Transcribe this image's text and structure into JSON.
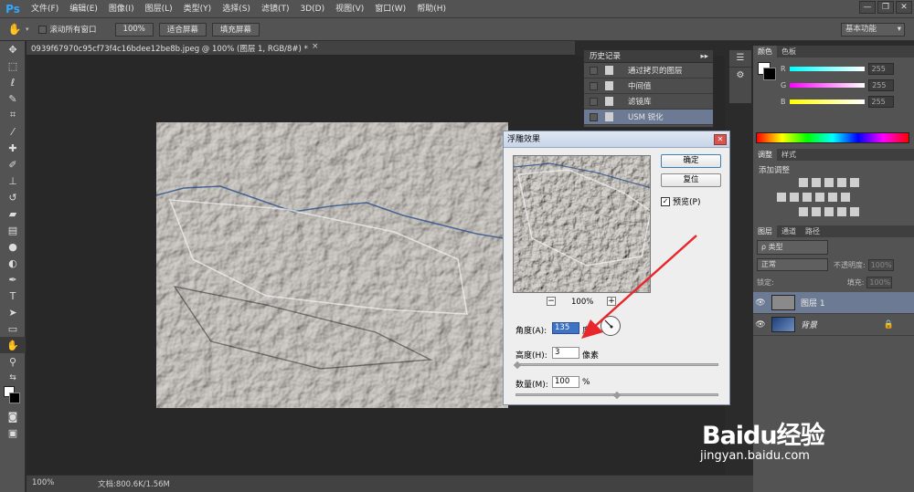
{
  "app": {
    "logo": "Ps"
  },
  "menu": [
    "文件(F)",
    "编辑(E)",
    "图像(I)",
    "图层(L)",
    "类型(Y)",
    "选择(S)",
    "滤镜(T)",
    "3D(D)",
    "视图(V)",
    "窗口(W)",
    "帮助(H)"
  ],
  "window_controls": [
    "—",
    "❐",
    "✕"
  ],
  "options": {
    "scroll_all_label": "滚动所有窗口",
    "zoom_label": "100%",
    "fit_screen": "适合屏幕",
    "fill_screen": "填充屏幕",
    "workspace": "基本功能"
  },
  "document": {
    "tab_title": "0939f67970c95cf73f4c16bdee12be8b.jpeg @ 100% (图层 1, RGB/8#) *",
    "close": "×"
  },
  "status": {
    "zoom": "100%",
    "doc_info": "文档:800.6K/1.56M"
  },
  "history": {
    "title": "历史记录",
    "items": [
      {
        "label": "通过拷贝的图层",
        "active": false
      },
      {
        "label": "中间值",
        "active": false
      },
      {
        "label": "滤镜库",
        "active": false
      },
      {
        "label": "USM 锐化",
        "active": true
      }
    ]
  },
  "color_panel": {
    "tabs": [
      "颜色",
      "色板"
    ],
    "channels": [
      {
        "name": "R",
        "value": "255"
      },
      {
        "name": "G",
        "value": "255"
      },
      {
        "name": "B",
        "value": "255"
      }
    ]
  },
  "adjust_panel": {
    "tabs": [
      "调整",
      "样式"
    ],
    "title": "添加调整"
  },
  "layers_panel": {
    "tabs": [
      "图层",
      "通道",
      "路径"
    ],
    "filter": "ρ 类型",
    "blend_mode": "正常",
    "opacity_label": "不透明度:",
    "opacity_value": "100%",
    "lock_label": "锁定:",
    "fill_label": "填充:",
    "fill_value": "100%",
    "layers": [
      {
        "name": "图层 1",
        "selected": true
      },
      {
        "name": "背景",
        "selected": false
      }
    ]
  },
  "dialog": {
    "title": "浮雕效果",
    "ok": "确定",
    "reset": "复位",
    "preview_label": "预览(P)",
    "preview_checked": true,
    "zoom": "100%",
    "angle_label": "角度(A):",
    "angle_value": "135",
    "angle_unit": "度",
    "height_label": "高度(H):",
    "height_value": "3",
    "height_unit": "像素",
    "amount_label": "数量(M):",
    "amount_value": "100",
    "amount_unit": "%",
    "height_slider_fraction": 0.01,
    "amount_slider_fraction": 0.5
  },
  "watermark": {
    "logo": "Baidu经验",
    "url": "jingyan.baidu.com"
  },
  "colors": {
    "accent_blue": "#31a8ff",
    "selection": "#6c7a93",
    "arrow_red": "#e8262b"
  }
}
